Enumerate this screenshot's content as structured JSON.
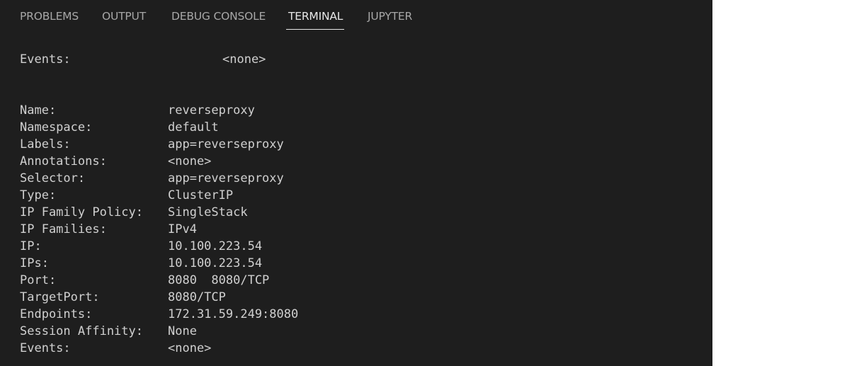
{
  "tabs": [
    {
      "label": "PROBLEMS",
      "active": false
    },
    {
      "label": "OUTPUT",
      "active": false
    },
    {
      "label": "DEBUG CONSOLE",
      "active": false
    },
    {
      "label": "TERMINAL",
      "active": true
    },
    {
      "label": "JUPYTER",
      "active": false
    }
  ],
  "terminal": {
    "top_event": {
      "key": "Events:",
      "value": "<none>"
    },
    "service": [
      {
        "key": "Name:",
        "value": "reverseproxy"
      },
      {
        "key": "Namespace:",
        "value": "default"
      },
      {
        "key": "Labels:",
        "value": "app=reverseproxy"
      },
      {
        "key": "Annotations:",
        "value": "<none>"
      },
      {
        "key": "Selector:",
        "value": "app=reverseproxy"
      },
      {
        "key": "Type:",
        "value": "ClusterIP"
      },
      {
        "key": "IP Family Policy:",
        "value": "SingleStack"
      },
      {
        "key": "IP Families:",
        "value": "IPv4"
      },
      {
        "key": "IP:",
        "value": "10.100.223.54"
      },
      {
        "key": "IPs:",
        "value": "10.100.223.54"
      },
      {
        "key": "Port:",
        "value": "8080  8080/TCP"
      },
      {
        "key": "TargetPort:",
        "value": "8080/TCP"
      },
      {
        "key": "Endpoints:",
        "value": "172.31.59.249:8080"
      },
      {
        "key": "Session Affinity:",
        "value": "None"
      },
      {
        "key": "Events:",
        "value": "<none>"
      }
    ]
  },
  "colors": {
    "panel_background": "#1e1e1e",
    "tab_inactive": "#a7a7a7",
    "tab_active": "#e7e7e7",
    "terminal_text": "#d0d0d0",
    "page_background": "#ffffff"
  }
}
